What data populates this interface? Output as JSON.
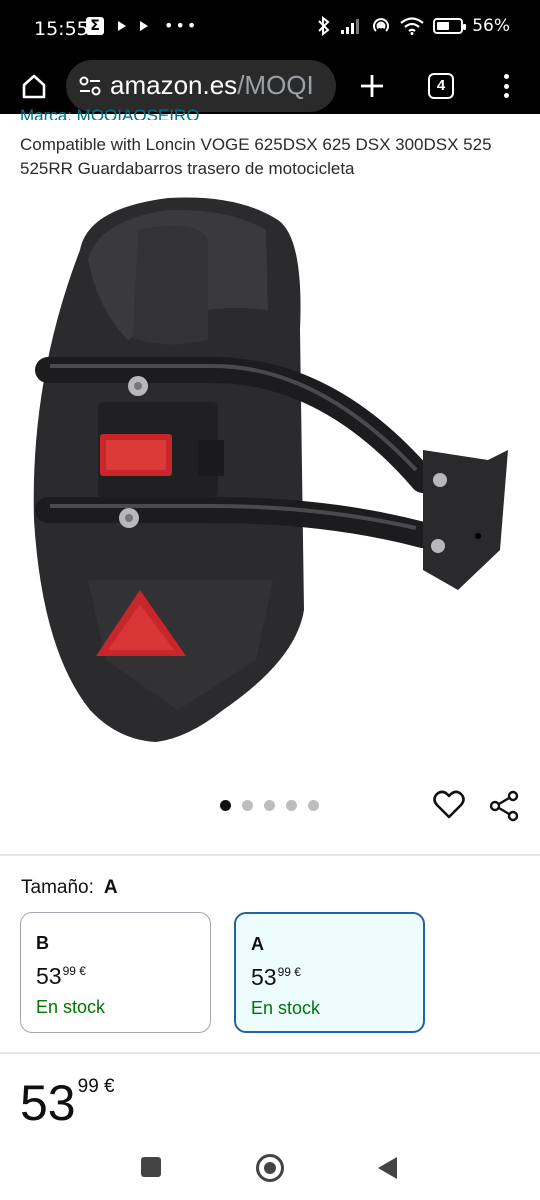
{
  "status_bar": {
    "time": "15:55",
    "notification_icons": [
      "sigma-icon",
      "play-icon",
      "play-icon",
      "more-dots-icon"
    ],
    "system_icons": [
      "bluetooth-icon",
      "signal-icon",
      "hotspot-icon",
      "wifi-icon",
      "battery-icon"
    ],
    "battery_level": 0.56,
    "battery_text": "56%"
  },
  "browser": {
    "url_domain": "amazon.es",
    "url_path": "/MOQI",
    "tab_count": "4",
    "icons": [
      "home-icon",
      "tune-icon",
      "plus-icon",
      "tabs-icon",
      "menu-dots-icon"
    ]
  },
  "product": {
    "brand": "Marca: MOQIAOSEIRO",
    "title": "Compatible with Loncin VOGE 625DSX 625 DSX 300DSX 525 525RR Guardabarros trasero de motocicleta",
    "image_alt": "Guardabarros trasero de motocicleta",
    "image_index": 0,
    "image_count": 5
  },
  "size": {
    "label": "Tamaño:",
    "selected": "A",
    "options": [
      {
        "name": "B",
        "price_whole": "53",
        "price_fraction": "99",
        "currency": "€",
        "stock": "En stock",
        "selected": false
      },
      {
        "name": "A",
        "price_whole": "53",
        "price_fraction": "99",
        "currency": "€",
        "stock": "En stock",
        "selected": true
      }
    ]
  },
  "price": {
    "whole": "53",
    "fraction": "99",
    "currency": "€"
  },
  "nav": {
    "icons": [
      "recents-icon",
      "home-circle-icon",
      "back-icon"
    ]
  },
  "colors": {
    "link": "#007185",
    "in_stock": "#007600",
    "selected_border": "#2162a1",
    "selected_bg": "#edfdff"
  }
}
